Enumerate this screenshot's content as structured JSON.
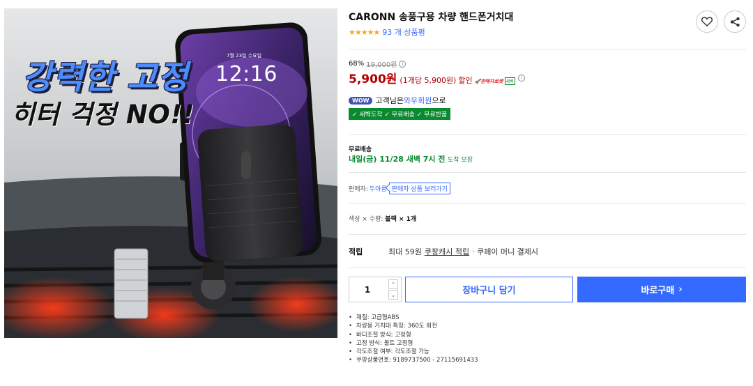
{
  "image": {
    "headline_line1": "강력한 고정",
    "headline_line2": "히터 걱정 NO!!",
    "phone_date": "7월 23일 수요일",
    "phone_time": "12:16"
  },
  "product": {
    "title": "CARONN 송풍구용 차량 핸드폰거치대",
    "stars": "★★★★★",
    "review_count": "93 개 상품평"
  },
  "price": {
    "discount_rate": "68%",
    "original_price": "19,000원",
    "info_icon": "ⓘ",
    "sale_price": "5,900원",
    "unit_price": "(1개당 5,900원)",
    "discount_label": "할인",
    "rocket_badge": "🚀판매자로켓",
    "dawn_badge": "새벽"
  },
  "wow": {
    "badge": "WOW",
    "text_prefix": "고객님은 ",
    "member": "와우회원",
    "text_suffix": "으로",
    "benefits": "✓ 새벽도착 ✓ 무료배송 ✓ 무료반품"
  },
  "shipping": {
    "label": "무료배송",
    "date": "내일(금) 11/28 새벽 7시 전",
    "guarantee": "도착 보장"
  },
  "seller": {
    "prefix": "판매자:",
    "name": "두아롱",
    "link": "판매자 상품 보러가기"
  },
  "option": {
    "label": "색상 × 수량:",
    "value": "블랙 × 1개"
  },
  "cash": {
    "label": "적립",
    "prefix": "최대 59원",
    "link": "쿠팡캐시 적립",
    "suffix": "· 쿠페이 머니 결제시"
  },
  "purchase": {
    "quantity": "1",
    "up": "⌃",
    "down": "⌄",
    "cart_label": "장바구니 담기",
    "buy_label": "바로구매",
    "buy_chevron": "›"
  },
  "specs": [
    "재질: 고급형ABS",
    "차량용 거치대 특징: 360도 회전",
    "바디조절 방식: 고정형",
    "고정 방식: 볼트 고정형",
    "각도조절 여부: 각도조절 가능",
    "쿠팡상품번호: 9189737500 - 27115691433"
  ],
  "icons": {
    "heart": "heart-icon",
    "share": "share-icon"
  },
  "colors": {
    "accent_blue": "#346aff",
    "price_red": "#ae0000",
    "rocket_green": "#0a8a2e",
    "star": "#f5a623",
    "wow_badge": "#3f54b6"
  }
}
